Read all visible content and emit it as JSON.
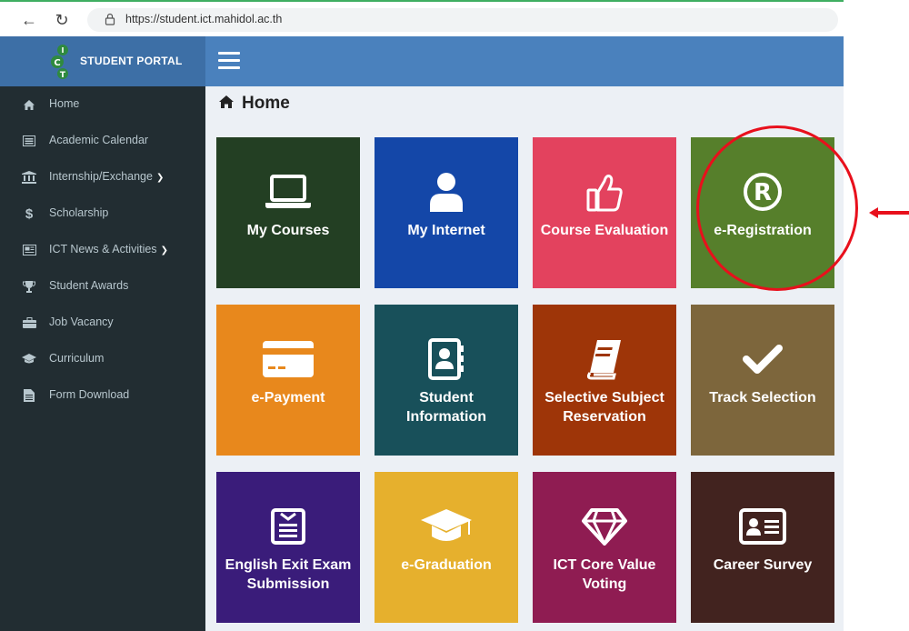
{
  "browser": {
    "url": "https://student.ict.mahidol.ac.th"
  },
  "header": {
    "brand": "STUDENT PORTAL",
    "header_color": "#4a81bd"
  },
  "sidebar": {
    "items": [
      {
        "label": "Home",
        "icon": "home-icon"
      },
      {
        "label": "Academic Calendar",
        "icon": "calendar-list-icon"
      },
      {
        "label": "Internship/Exchange",
        "icon": "institution-icon",
        "has_dropdown": true
      },
      {
        "label": "Scholarship",
        "icon": "dollar-icon"
      },
      {
        "label": "ICT News & Activities",
        "icon": "newspaper-icon",
        "has_dropdown": true
      },
      {
        "label": "Student Awards",
        "icon": "trophy-icon"
      },
      {
        "label": "Job Vacancy",
        "icon": "briefcase-icon"
      },
      {
        "label": "Curriculum",
        "icon": "graduation-cap-icon"
      },
      {
        "label": "Form Download",
        "icon": "file-icon"
      }
    ]
  },
  "main": {
    "title": "Home",
    "tiles": [
      {
        "label": "My Courses",
        "color": "#233f23",
        "icon": "laptop-icon"
      },
      {
        "label": "My Internet",
        "color": "#1447a8",
        "icon": "user-icon"
      },
      {
        "label": "Course Evaluation",
        "color": "#e3425e",
        "icon": "thumbs-up-icon"
      },
      {
        "label": "e-Registration",
        "color": "#567f2b",
        "icon": "registered-icon"
      },
      {
        "label": "e-Payment",
        "color": "#e8881c",
        "icon": "credit-card-icon"
      },
      {
        "label": "Student Information",
        "color": "#18505a",
        "icon": "address-book-icon"
      },
      {
        "label": "Selective Subject Reservation",
        "color": "#9e3508",
        "icon": "book-icon"
      },
      {
        "label": "Track Selection",
        "color": "#7d663c",
        "icon": "check-icon"
      },
      {
        "label": "English Exit Exam Submission",
        "color": "#3a1c7a",
        "icon": "form-icon"
      },
      {
        "label": "e-Graduation",
        "color": "#e6b02d",
        "icon": "graduation-cap-icon"
      },
      {
        "label": "ICT Core Value Voting",
        "color": "#8f1c52",
        "icon": "diamond-icon"
      },
      {
        "label": "Career Survey",
        "color": "#42231f",
        "icon": "id-card-icon"
      }
    ]
  },
  "annotation": {
    "highlight_color": "#e8101c"
  }
}
